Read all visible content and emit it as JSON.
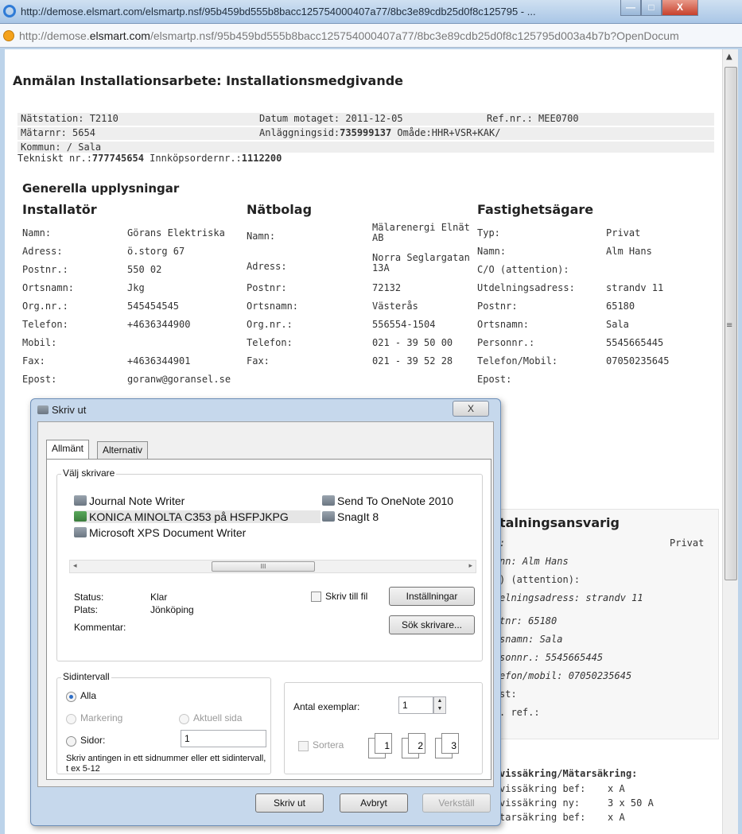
{
  "browser": {
    "title": "http://demose.elsmart.com/elsmartp.nsf/95b459bd555b8bacc125754000407a77/8bc3e89cdb25d0f8c125795 - ...",
    "url_pre": "http://demose.",
    "url_host": "elsmart.com",
    "url_post": "/elsmartp.nsf/95b459bd555b8bacc125754000407a77/8bc3e89cdb25d0f8c125795d003a4b7b?OpenDocum",
    "minimize": "—",
    "maximize": "□",
    "close": "X"
  },
  "page": {
    "title": "Anmälan Installationsarbete: Installationsmedgivande",
    "header_rows": [
      {
        "c1": "Nätstation: T2110",
        "c2": "Datum motaget: 2011-12-05",
        "c3": "Ref.nr.: MEE0700"
      },
      {
        "c1": "Mätarnr: 5654",
        "c2_pre": "Anläggningsid:",
        "c2_bold": "735999137",
        "c2_post": " Omåde:HHR+VSR+KAK/"
      },
      {
        "c1": "Kommun: / Sala"
      },
      {
        "c1_pre": "Tekniskt nr.:",
        "c1_bold": "777745654",
        "c1_mid": " Innköpsordernr.:",
        "c1_bold2": "1112200"
      }
    ],
    "section_title": "Generella upplysningar",
    "installator": {
      "heading": "Installatör",
      "rows": [
        {
          "label": "Namn:",
          "value": "Görans Elektriska"
        },
        {
          "label": "Adress:",
          "value": "ö.storg 67"
        },
        {
          "label": "Postnr.:",
          "value": "550 02"
        },
        {
          "label": "Ortsnamn:",
          "value": "Jkg"
        },
        {
          "label": "Org.nr.:",
          "value": "545454545"
        },
        {
          "label": "Telefon:",
          "value": "+4636344900"
        },
        {
          "label": "Mobil:",
          "value": ""
        },
        {
          "label": "Fax:",
          "value": "+4636344901"
        },
        {
          "label": "Epost:",
          "value": "goranw@goransel.se"
        }
      ]
    },
    "natbolag": {
      "heading": "Nätbolag",
      "rows": [
        {
          "label": "Namn:",
          "value": "Mälarenergi Elnät AB"
        },
        {
          "label": "Adress:",
          "value": "Norra Seglargatan 13A"
        },
        {
          "label": "Postnr:",
          "value": "72132"
        },
        {
          "label": "Ortsnamn:",
          "value": "Västerås"
        },
        {
          "label": "Org.nr.:",
          "value": "556554-1504"
        },
        {
          "label": "Telefon:",
          "value": "021 - 39 50 00"
        },
        {
          "label": "Fax:",
          "value": "021 - 39 52 28"
        }
      ]
    },
    "fastighetsagare": {
      "heading": "Fastighetsägare",
      "rows": [
        {
          "label": "Typ:",
          "value": "Privat"
        },
        {
          "label": "Namn:",
          "value": "Alm Hans"
        },
        {
          "label": "C/O (attention):",
          "value": ""
        },
        {
          "label": "Utdelningsadress:",
          "value": "strandv 11"
        },
        {
          "label": "Postnr:",
          "value": "65180"
        },
        {
          "label": "Ortsnamn:",
          "value": "Sala"
        },
        {
          "label": "Personnr.:",
          "value": "5545665445"
        },
        {
          "label": "Telefon/Mobil:",
          "value": "07050235645"
        },
        {
          "label": "Epost:",
          "value": ""
        }
      ]
    },
    "betalning": {
      "heading": "talningsansvarig",
      "type_value": "Privat",
      "lines": [
        ":",
        "nn: Alm Hans",
        ") (attention):",
        "elningsadress: strandv 11",
        "tnr: 65180",
        "snamn: Sala",
        "sonnr.: 5545665445",
        "efon/mobil: 07050235645",
        "st:",
        ". ref.:"
      ]
    },
    "sakring": {
      "heading": "vissäkring/Mätarsäkring:",
      "lines": [
        {
          "label": "vissäkring bef:",
          "value": "x A"
        },
        {
          "label": "vissäkring ny:",
          "value": "3 x 50 A"
        },
        {
          "label": "tarsäkring bef:",
          "value": "x A"
        }
      ]
    }
  },
  "dialog": {
    "title": "Skriv ut",
    "close": "X",
    "tabs": [
      "Allmänt",
      "Alternativ"
    ],
    "select_printer_label": "Välj skrivare",
    "printers_left": [
      "Journal Note Writer",
      "KONICA MINOLTA C353 på HSFPJKPG",
      "Microsoft XPS Document Writer"
    ],
    "printers_right": [
      "Send To OneNote 2010",
      "SnagIt 8"
    ],
    "status_label": "Status:",
    "status_value": "Klar",
    "location_label": "Plats:",
    "location_value": "Jönköping",
    "comment_label": "Kommentar:",
    "print_to_file": "Skriv till fil",
    "settings_button": "Inställningar",
    "find_printer_button": "Sök skrivare...",
    "page_range_label": "Sidintervall",
    "all": "Alla",
    "selection": "Markering",
    "current_page": "Aktuell sida",
    "pages": "Sidor:",
    "pages_value": "1",
    "hint": "Skriv antingen in ett sidnummer eller ett sidintervall, t ex 5-12",
    "copies_label": "Antal exemplar:",
    "copies_value": "1",
    "collate": "Sortera",
    "print_button": "Skriv ut",
    "cancel_button": "Avbryt",
    "apply_button": "Verkställ"
  }
}
